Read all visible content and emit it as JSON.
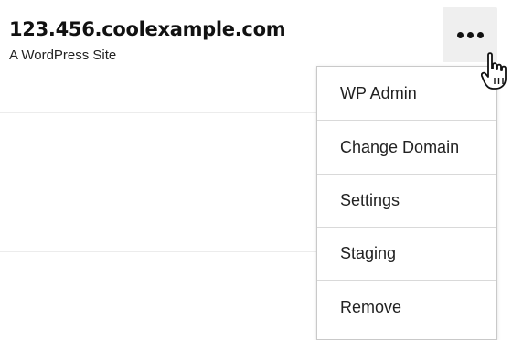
{
  "site": {
    "title": "123.456.coolexample.com",
    "subtitle": "A WordPress Site"
  },
  "more_button": {
    "icon": "more-horizontal-icon"
  },
  "menu": {
    "items": [
      {
        "label": "WP Admin"
      },
      {
        "label": "Change Domain"
      },
      {
        "label": "Settings"
      },
      {
        "label": "Staging"
      },
      {
        "label": "Remove"
      }
    ]
  },
  "cursor": {
    "icon": "hand-pointer-icon"
  },
  "colors": {
    "button_bg": "#efefef",
    "menu_border": "#c9c9c9",
    "text": "#222222"
  }
}
